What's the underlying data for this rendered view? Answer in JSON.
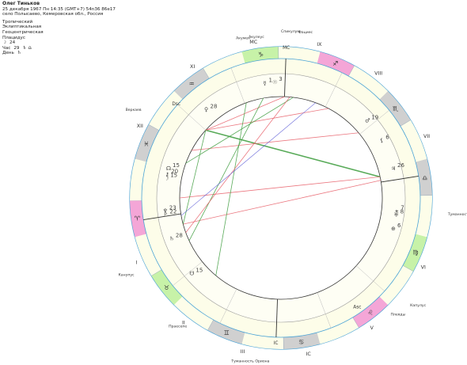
{
  "person": {
    "name": "Олег Тиньков",
    "datetime_line": "25 декабря 1967  Пн  14:35 (GMT+7) 54n36  86e17",
    "place": "село Полысаево, Кемеровская обл., Россия",
    "settings": [
      "Тропический",
      "Эклиптикальная",
      "Геоцентрическая",
      "Плацидус"
    ],
    "moon_phase": {
      "symbol": "☽",
      "value": "24"
    },
    "hour": {
      "label": "Час",
      "value": "29",
      "rulers": "♄ ♎"
    },
    "day": {
      "label": "День",
      "ruler": "♄"
    }
  },
  "angles": {
    "asc": "Asc",
    "dsc": "Dsc",
    "mc": "MC",
    "ic": "IC"
  },
  "houses": [
    "I",
    "II",
    "III",
    "IC",
    "V",
    "VI",
    "VII",
    "VIII",
    "IX",
    "MC",
    "XI",
    "XII"
  ],
  "zodiac_signs": [
    "♈",
    "♉",
    "♊",
    "♋",
    "♌",
    "♍",
    "♎",
    "♏",
    "♐",
    "♑",
    "♒",
    "♓"
  ],
  "planets": [
    {
      "name": "mercury",
      "glyph": "☿",
      "deg": "1"
    },
    {
      "name": "sun",
      "glyph": "☉",
      "deg": "3"
    },
    {
      "name": "mars",
      "glyph": "♂",
      "deg": "19"
    },
    {
      "name": "lilith",
      "glyph": "⚸",
      "deg": "6"
    },
    {
      "name": "venus",
      "glyph": "♀",
      "deg": "28"
    },
    {
      "name": "uranus",
      "glyph": "♅",
      "deg": "8"
    },
    {
      "name": "pluto",
      "glyph": "♇",
      "deg": "22"
    },
    {
      "name": "jupiter",
      "glyph": "♃",
      "deg": "26"
    },
    {
      "name": "north-node",
      "glyph": "☊",
      "deg": "15"
    },
    {
      "name": "moon",
      "glyph": "☽",
      "deg": "15"
    },
    {
      "name": "neptune",
      "glyph": "♆",
      "deg": "23"
    },
    {
      "name": "saturn",
      "glyph": "♄",
      "deg": "28"
    },
    {
      "name": "chiron",
      "glyph": "⚷",
      "deg": "20"
    },
    {
      "name": "selena",
      "glyph": "⚹",
      "deg": "7"
    },
    {
      "name": "south-node",
      "glyph": "☋",
      "deg": "15"
    },
    {
      "name": "pars",
      "glyph": "⊕",
      "deg": "6"
    }
  ],
  "stars": [
    {
      "name": "Акулеус"
    },
    {
      "name": "Акумен"
    },
    {
      "name": "Спикулум"
    },
    {
      "name": "Фациес"
    },
    {
      "name": "Веркаев"
    },
    {
      "name": "Канупус"
    },
    {
      "name": "Туманность Андромеды"
    },
    {
      "name": "Капулус"
    },
    {
      "name": "Плеяды"
    },
    {
      "name": "Туманность Ориона"
    },
    {
      "name": "Праесепе"
    }
  ],
  "colors": {
    "fire": "#f4a6d7",
    "earth": "#c7f2a8",
    "air": "#d0d0d0",
    "water": "#d0d0d0",
    "ring_border": "#4aa3d6",
    "house_fill": "#fdfde9",
    "aspect_red": "#e8606a",
    "aspect_green": "#3c9c3c",
    "aspect_blue": "#5b5bd6"
  }
}
